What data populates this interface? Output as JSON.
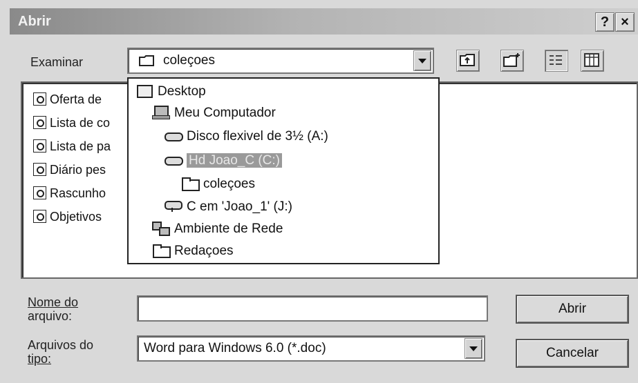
{
  "window": {
    "title": "Abrir",
    "help_button": "?",
    "close_button": "×"
  },
  "lookin": {
    "label": "Examinar",
    "value": "coleçoes"
  },
  "files": [
    {
      "name": "Oferta de "
    },
    {
      "name": "Lista de co"
    },
    {
      "name": "Lista de pa"
    },
    {
      "name": "Diário pes"
    },
    {
      "name": "Rascunho"
    },
    {
      "name": "Objetivos "
    }
  ],
  "dropdown_items": [
    {
      "label": "Desktop",
      "icon": "desktop-icon"
    },
    {
      "label": "Meu Computador",
      "icon": "computer-icon"
    },
    {
      "label": "Disco flexivel de 3½ (A:)",
      "icon": "floppy-drive-icon"
    },
    {
      "label": "Hd Joao_C (C:)",
      "icon": "hard-drive-icon",
      "selected": true
    },
    {
      "label": "coleçoes",
      "icon": "folder-open-icon"
    },
    {
      "label": "C em 'Joao_1' (J:)",
      "icon": "network-drive-icon"
    },
    {
      "label": "Ambiente de Rede",
      "icon": "network-icon"
    },
    {
      "label": "Redaçoes",
      "icon": "folder-icon"
    }
  ],
  "filename": {
    "label_line1": "Nome do",
    "label_line2": "arquivo:",
    "value": ""
  },
  "filetype": {
    "label_line1": "Arquivos do",
    "label_line2": "tipo:",
    "value": "Word para Windows 6.0 (*.doc)"
  },
  "buttons": {
    "open": "Abrir",
    "cancel": "Cancelar"
  }
}
